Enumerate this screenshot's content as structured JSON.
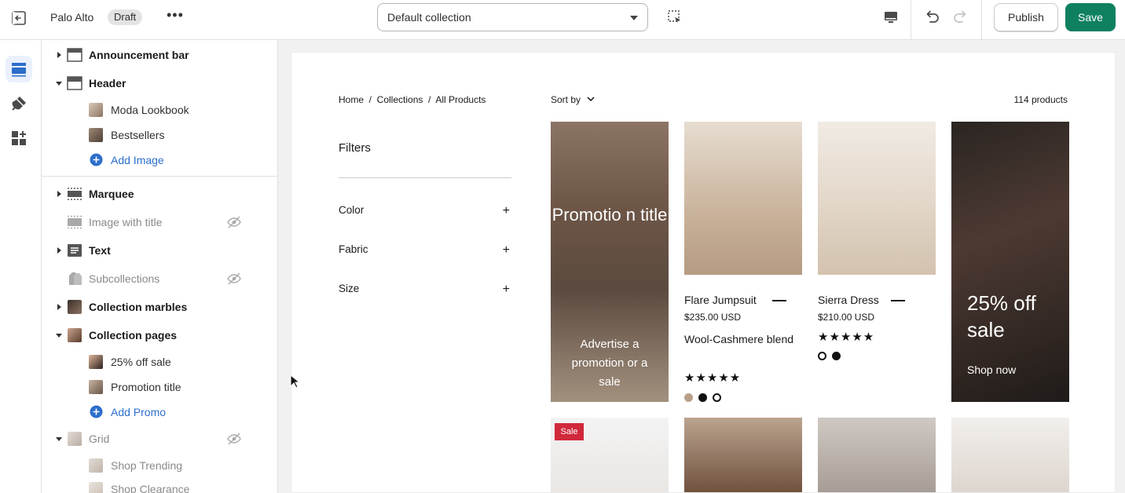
{
  "topbar": {
    "store_name": "Palo Alto",
    "status_badge": "Draft",
    "more_label": "•••",
    "collection_select": "Default collection",
    "publish_label": "Publish",
    "save_label": "Save"
  },
  "sidebar": {
    "sections": [
      {
        "label": "Announcement bar"
      },
      {
        "label": "Header"
      },
      {
        "label": "Moda Lookbook"
      },
      {
        "label": "Bestsellers"
      },
      {
        "label": "Add Image"
      },
      {
        "label": "Marquee"
      },
      {
        "label": "Image with title"
      },
      {
        "label": "Text"
      },
      {
        "label": "Subcollections"
      },
      {
        "label": "Collection marbles"
      },
      {
        "label": "Collection pages"
      },
      {
        "label": "25% off sale"
      },
      {
        "label": "Promotion title"
      },
      {
        "label": "Add Promo"
      },
      {
        "label": "Grid"
      },
      {
        "label": "Shop Trending"
      },
      {
        "label": "Shop Clearance"
      }
    ]
  },
  "preview": {
    "breadcrumb": "Home  /  Collections  /  All Products",
    "sort_label": "Sort by",
    "product_count": "114 products",
    "filters_title": "Filters",
    "filters": [
      "Color",
      "Fabric",
      "Size"
    ],
    "promo": {
      "title": "Promotio n title",
      "text": "Advertise a promotion or a sale"
    },
    "products": [
      {
        "name": "Flare Jumpsuit",
        "price": "$235.00 USD",
        "subtitle": "Wool-Cashmere blend",
        "stars": "★★★★★"
      },
      {
        "name": "Sierra Dress",
        "price": "$210.00 USD",
        "stars": "★★★★★"
      }
    ],
    "sale_card": {
      "title": "25% off sale",
      "link": "Shop now"
    },
    "sale_badge": "Sale"
  },
  "colors": {
    "accent": "#2c6ecb",
    "save": "#0e8060",
    "sale_badge": "#d1293c"
  }
}
